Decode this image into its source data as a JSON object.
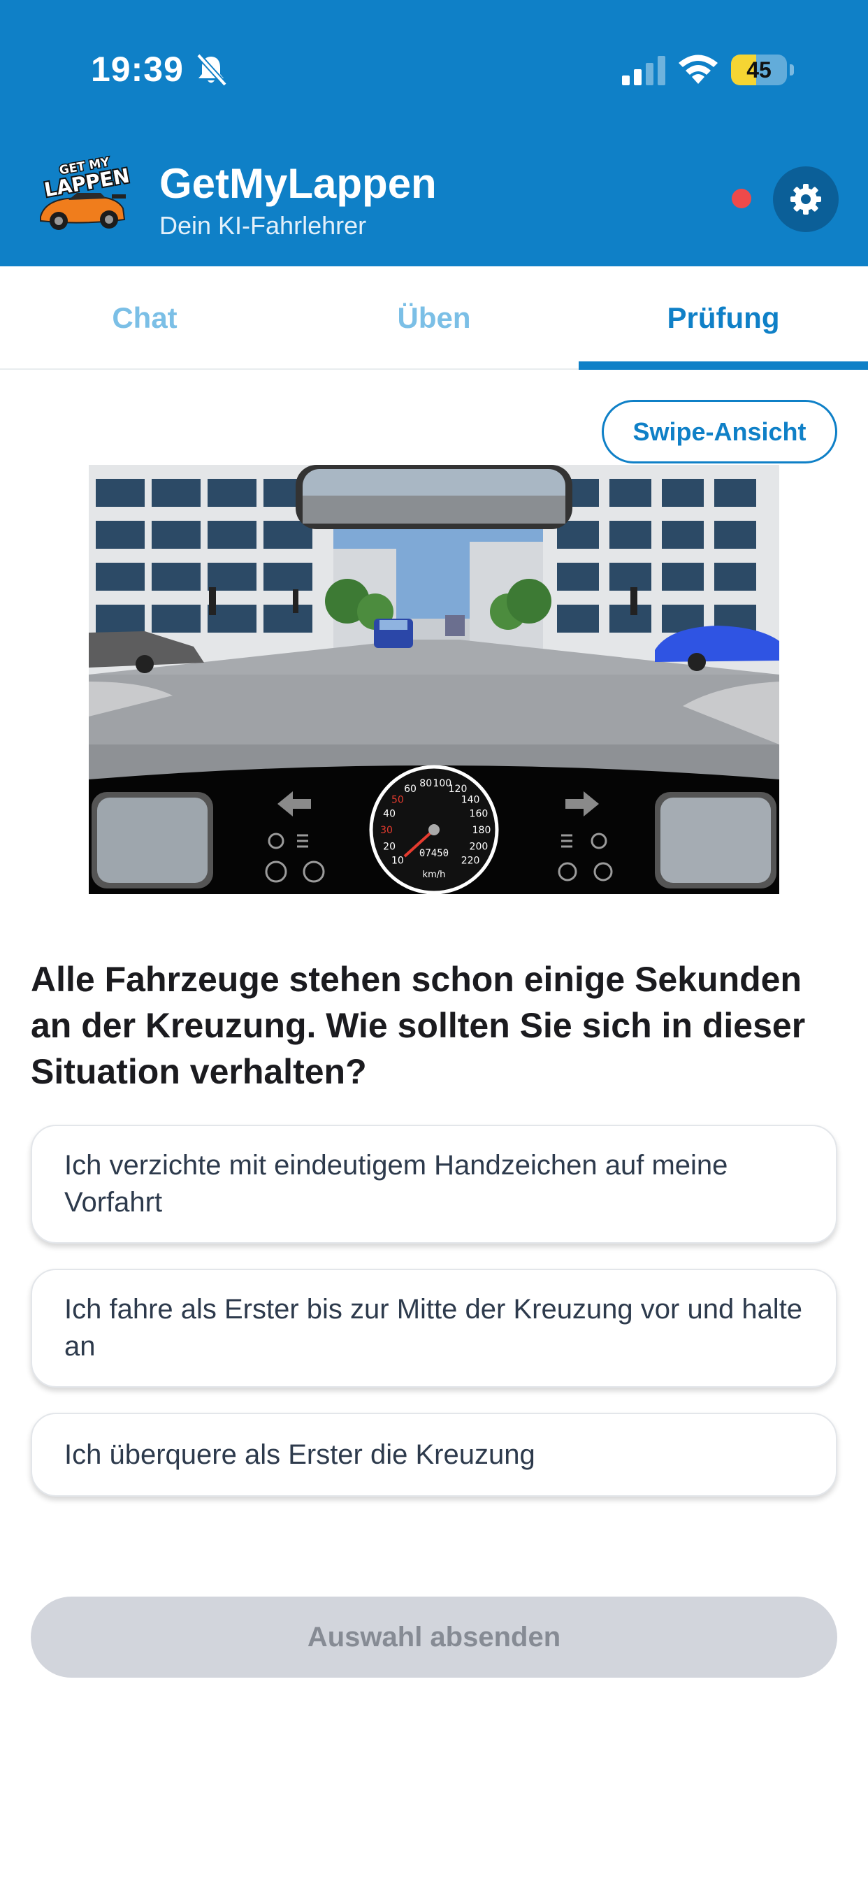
{
  "status_bar": {
    "time": "19:39",
    "battery": "45",
    "battery_level": 0.45,
    "icons": [
      "bell-slash-icon",
      "cellular-signal-icon",
      "wifi-icon",
      "battery-icon"
    ]
  },
  "header": {
    "logo_text": "GET MY LAPPEN",
    "title": "GetMyLappen",
    "subtitle": "Dein KI-Fahrlehrer",
    "settings_icon": "gear-icon",
    "notification_color": "#ef4a4a"
  },
  "colors": {
    "brand": "#0f80c7",
    "tab_inactive": "#7bbfe6",
    "disabled_button": "#d2d5dc"
  },
  "tabs": [
    {
      "label": "Chat",
      "active": false
    },
    {
      "label": "Üben",
      "active": false
    },
    {
      "label": "Prüfung",
      "active": true
    }
  ],
  "swipe_button": {
    "label": "Swipe-Ansicht"
  },
  "dashboard": {
    "speed_ticks": [
      "10",
      "20",
      "30",
      "40",
      "50",
      "60",
      "80",
      "100",
      "120",
      "140",
      "160",
      "180",
      "200",
      "220"
    ],
    "odometer": "07450",
    "unit": "km/h",
    "icons": [
      "arrow-left-icon",
      "arrow-right-icon",
      "airbag-icon",
      "headlight-icon",
      "abs-icon",
      "steering-icon",
      "seatbelt-icon",
      "warning-light-icon"
    ]
  },
  "question": {
    "text": "Alle Fahrzeuge stehen schon einige Sekunden an der Kreuzung. Wie sollten Sie sich in dieser Situation verhalten?",
    "answers": [
      "Ich verzichte mit eindeutigem Handzeichen auf meine Vorfahrt",
      "Ich fahre als Erster bis zur Mitte der Kreuzung vor und halte an",
      "Ich überquere als Erster die Kreuzung"
    ]
  },
  "submit_button": {
    "label": "Auswahl absenden",
    "enabled": false
  }
}
